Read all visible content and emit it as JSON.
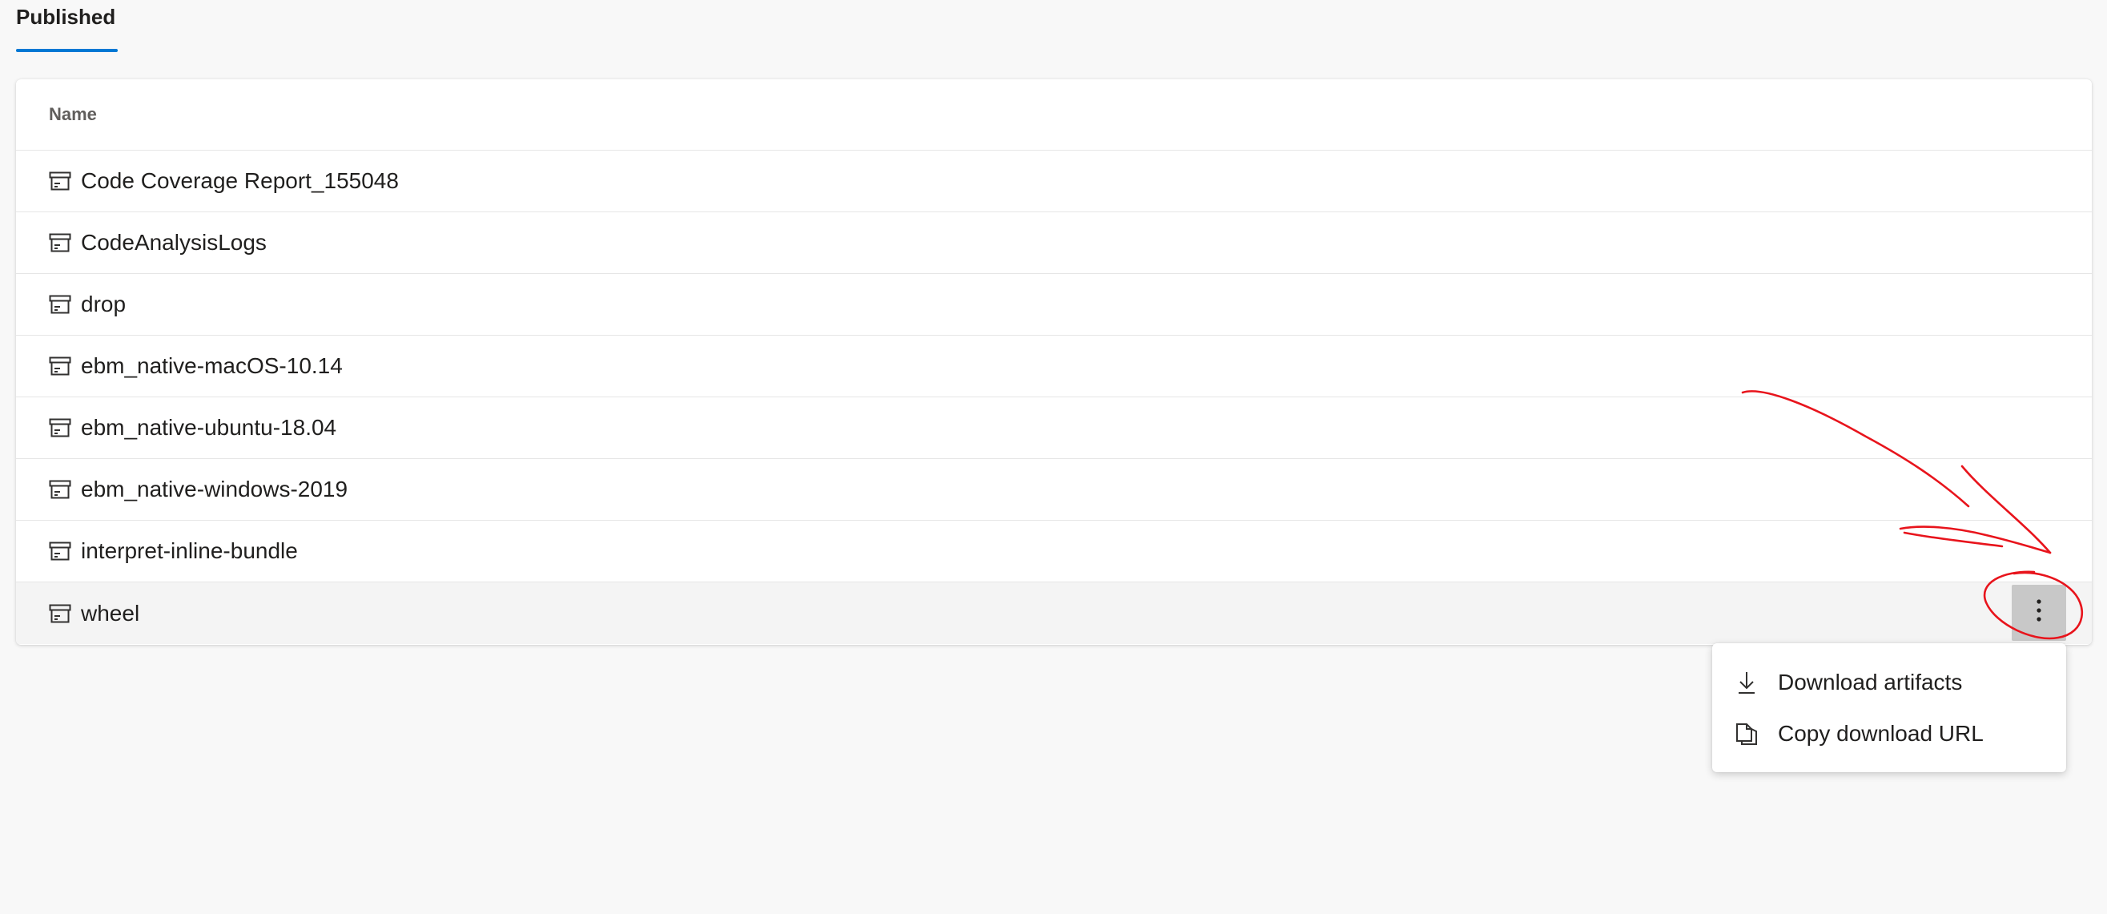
{
  "tabs": [
    {
      "label": "Published",
      "selected": true
    }
  ],
  "table": {
    "column_header": "Name",
    "rows": [
      {
        "name": "Code Coverage Report_155048"
      },
      {
        "name": "CodeAnalysisLogs"
      },
      {
        "name": "drop"
      },
      {
        "name": "ebm_native-macOS-10.14"
      },
      {
        "name": "ebm_native-ubuntu-18.04"
      },
      {
        "name": "ebm_native-windows-2019"
      },
      {
        "name": "interpret-inline-bundle"
      },
      {
        "name": "wheel"
      }
    ],
    "row_icon": "artifact-box-icon",
    "more_icon": "more-vertical-icon"
  },
  "context_menu": {
    "items": [
      {
        "label": "Download artifacts",
        "icon": "download-icon"
      },
      {
        "label": "Copy download URL",
        "icon": "copy-icon"
      }
    ]
  },
  "colors": {
    "accent": "#0078d4",
    "annotation": "#e8141c",
    "background": "#f8f8f8"
  }
}
